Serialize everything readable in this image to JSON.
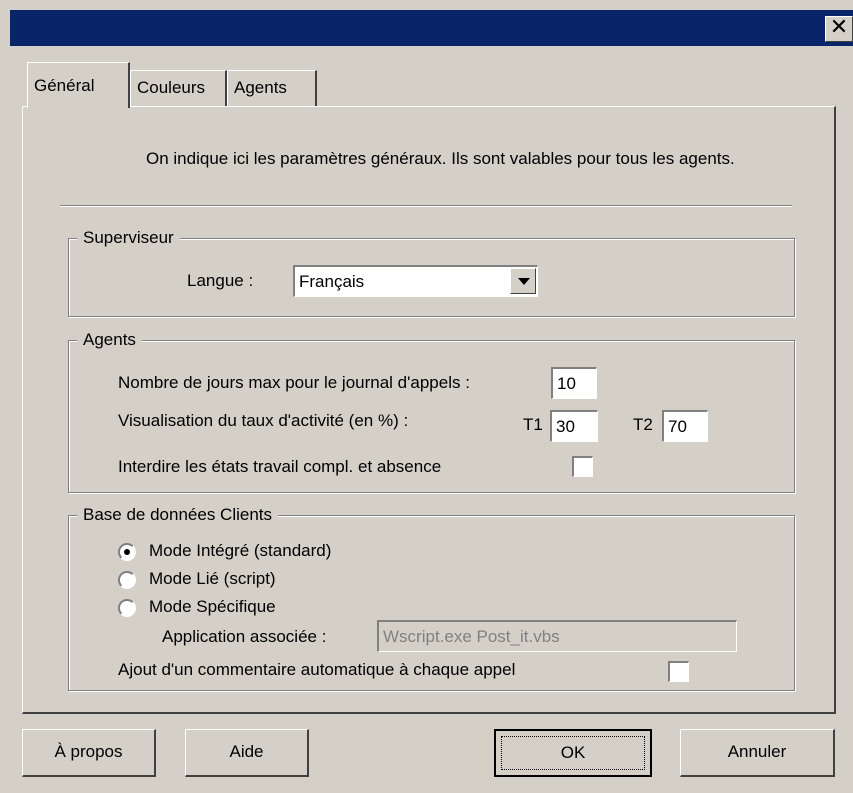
{
  "window": {
    "close_glyph": "✕"
  },
  "tabs": [
    {
      "label": "Général",
      "active": true
    },
    {
      "label": "Couleurs",
      "active": false
    },
    {
      "label": "Agents",
      "active": false
    }
  ],
  "general": {
    "intro_text": "On indique ici les paramètres généraux. Ils sont valables pour tous les agents.",
    "supervisor": {
      "group_label": "Superviseur",
      "language_label": "Langue :",
      "language_value": "Français"
    },
    "agents": {
      "group_label": "Agents",
      "max_days_label": "Nombre de jours max pour le journal d'appels :",
      "max_days_value": "10",
      "activity_label": "Visualisation du taux d'activité (en %) :",
      "t1_label": "T1",
      "t1_value": "30",
      "t2_label": "T2",
      "t2_value": "70",
      "forbid_label": "Interdire les états travail compl. et absence",
      "forbid_checked": false
    },
    "client_db": {
      "group_label": "Base de données Clients",
      "modes": [
        {
          "label": "Mode Intégré (standard)",
          "selected": true
        },
        {
          "label": "Mode Lié (script)",
          "selected": false
        },
        {
          "label": "Mode Spécifique",
          "selected": false
        }
      ],
      "app_label": "Application associée :",
      "app_value": "Wscript.exe Post_it.vbs",
      "comment_label": "Ajout d'un commentaire automatique à chaque appel",
      "comment_checked": false
    }
  },
  "buttons": {
    "about": "À propos",
    "help": "Aide",
    "ok": "OK",
    "cancel": "Annuler"
  },
  "colors": {
    "title_bar": "#0a246a",
    "face": "#d4d0c8"
  }
}
